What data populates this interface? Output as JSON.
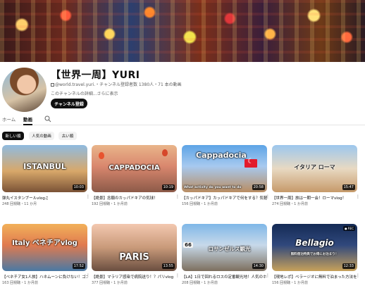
{
  "channel": {
    "title": "【世界一周】YURI",
    "handle": "@world.travel.yuri.",
    "stats": "・チャンネル登録者数 1380人・71 本の動画",
    "description": "このチャンネルの詳細...さらに表示",
    "subscribe_label": "チャンネル登録"
  },
  "tabs": [
    {
      "label": "ホーム"
    },
    {
      "label": "動画"
    }
  ],
  "filters": [
    {
      "label": "新しい順"
    },
    {
      "label": "人気の動画"
    },
    {
      "label": "古い順"
    }
  ],
  "videos": [
    {
      "title": "弾丸イスタンブールvlog♫",
      "meta": "248 回視聴・11 か月",
      "duration": "10:03",
      "thumb_text": "ISTANBUL"
    },
    {
      "title": "【絶景】念願のカッパドキアの気球！",
      "meta": "192 回視聴・1 か月前",
      "duration": "10:19",
      "thumb_text": "CAPPADOCIA"
    },
    {
      "title": "【カッパドキア】カッパドキアで何をする？気軽にできるアクティビティ紹介♪",
      "meta": "156 回視聴・1 か月前",
      "duration": "20:58",
      "thumb_text": "Cappadocia",
      "thumb_subtext": "What activity do you want to do"
    },
    {
      "title": "【世界一周】旅は一期一会！ローマvlog！",
      "meta": "274 回視聴・1 か月前",
      "duration": "15:47",
      "thumb_text": "イタリア ローマ"
    },
    {
      "title": "【ベネチア女1人旅】ハネムーンに負けない！ゴンドラに乗って1人でも大満喫なお...",
      "meta": "163 回視聴・1 か月前",
      "duration": "17:52",
      "thumb_text": "Italy ベネチアvlog"
    },
    {
      "title": "【絶景】マラリア感染で病院送り！？パリvlog",
      "meta": "377 回視聴・1 か月前",
      "duration": "13:55",
      "thumb_text": "PARIS"
    },
    {
      "title": "【LA】1日で回れるロスの定番観光地！人気のホットドッグや大谷選手の聖地などモデ...",
      "meta": "208 回視聴・1 か月前",
      "duration": "14:30",
      "thumb_text": "ロサンゼルス観光",
      "thumb_badge": "66"
    },
    {
      "title": "【現地レポ】ベラージオに無料で泊まった方法を紹介！",
      "meta": "156 回視聴・1 か月前",
      "duration": "12:33",
      "thumb_text": "Bellagio",
      "thumb_subtext": "無料宿泊特典でお得にお泊まり！"
    }
  ]
}
